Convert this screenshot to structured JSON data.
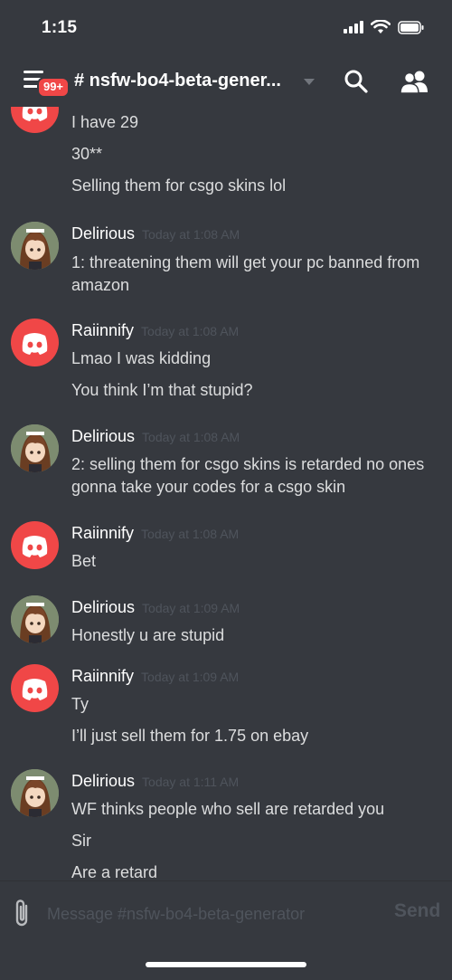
{
  "status_bar": {
    "time": "1:15"
  },
  "header": {
    "badge": "99+",
    "channel_title": "# nsfw-bo4-beta-gener..."
  },
  "messages": [
    {
      "author": "",
      "timestamp": "",
      "avatar": "discord-logo-icon",
      "lines": [
        "I have 29",
        "30**",
        "Selling them for csgo skins lol"
      ]
    },
    {
      "author": "Delirious",
      "timestamp": "Today at 1:08 AM",
      "avatar": "anime-avatar",
      "lines": [
        "1: threatening them will get your pc banned from amazon"
      ]
    },
    {
      "author": "Raiinnify",
      "timestamp": "Today at 1:08 AM",
      "avatar": "discord-logo-icon",
      "lines": [
        "Lmao I was kidding",
        "You think I’m that stupid?"
      ]
    },
    {
      "author": "Delirious",
      "timestamp": "Today at 1:08 AM",
      "avatar": "anime-avatar",
      "lines": [
        "2: selling them for csgo skins is retarded no ones gonna take your codes for a csgo skin"
      ]
    },
    {
      "author": "Raiinnify",
      "timestamp": "Today at 1:08 AM",
      "avatar": "discord-logo-icon",
      "lines": [
        "Bet"
      ]
    },
    {
      "author": "Delirious",
      "timestamp": "Today at 1:09 AM",
      "avatar": "anime-avatar",
      "lines": [
        "Honestly u are stupid"
      ]
    },
    {
      "author": "Raiinnify",
      "timestamp": "Today at 1:09 AM",
      "avatar": "discord-logo-icon",
      "lines": [
        "Ty",
        "I’ll just sell them for 1.75 on ebay"
      ]
    },
    {
      "author": "Delirious",
      "timestamp": "Today at 1:11 AM",
      "avatar": "anime-avatar",
      "lines": [
        "WF thinks people who sell are retarded you",
        "Sir",
        "Are a retard"
      ]
    }
  ],
  "composer": {
    "placeholder": "Message #nsfw-bo4-beta-generator",
    "send_label": "Send"
  },
  "colors": {
    "background": "#36393f",
    "badge": "#f04747",
    "discord_avatar": "#f04747",
    "muted": "#4f545c"
  }
}
